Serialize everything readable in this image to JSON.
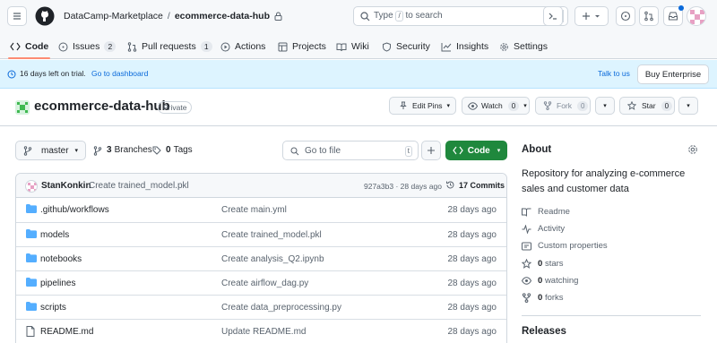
{
  "header": {
    "org": "DataCamp-Marketplace",
    "separator": "/",
    "repo": "ecommerce-data-hub",
    "search_prefix": "Type",
    "search_key": "/",
    "search_suffix": "to search"
  },
  "nav": {
    "tabs": [
      {
        "label": "Code",
        "selected": true
      },
      {
        "label": "Issues",
        "count": "2"
      },
      {
        "label": "Pull requests",
        "count": "1"
      },
      {
        "label": "Actions"
      },
      {
        "label": "Projects"
      },
      {
        "label": "Wiki"
      },
      {
        "label": "Security"
      },
      {
        "label": "Insights"
      },
      {
        "label": "Settings"
      }
    ]
  },
  "banner": {
    "trial": "16 days left on trial.",
    "dashboard_link": "Go to dashboard",
    "talk": "Talk to us",
    "buy": "Buy Enterprise"
  },
  "repo": {
    "name": "ecommerce-data-hub",
    "visibility": "Private",
    "edit_pins": "Edit Pins",
    "watch": "Watch",
    "watch_count": "0",
    "fork": "Fork",
    "fork_count": "0",
    "star": "Star",
    "star_count": "0"
  },
  "toolbar": {
    "branch": "master",
    "branches_count": "3",
    "branches_label": "Branches",
    "tags_count": "0",
    "tags_label": "Tags",
    "goto_placeholder": "Go to file",
    "goto_key": "t",
    "code_label": "Code"
  },
  "commit": {
    "author": "StanKonkin",
    "message": "Create trained_model.pkl",
    "hash_age": "927a3b3 · 28 days ago",
    "commits": "17 Commits"
  },
  "files": [
    {
      "name": ".github/workflows",
      "type": "dir",
      "message": "Create main.yml",
      "age": "28 days ago"
    },
    {
      "name": "models",
      "type": "dir",
      "message": "Create trained_model.pkl",
      "age": "28 days ago"
    },
    {
      "name": "notebooks",
      "type": "dir",
      "message": "Create analysis_Q2.ipynb",
      "age": "28 days ago"
    },
    {
      "name": "pipelines",
      "type": "dir",
      "message": "Create airflow_dag.py",
      "age": "28 days ago"
    },
    {
      "name": "scripts",
      "type": "dir",
      "message": "Create data_preprocessing.py",
      "age": "28 days ago"
    },
    {
      "name": "README.md",
      "type": "file",
      "message": "Update README.md",
      "age": "28 days ago"
    }
  ],
  "about": {
    "title": "About",
    "description": "Repository for analyzing e-commerce sales and customer data",
    "readme": "Readme",
    "activity": "Activity",
    "custom": "Custom properties",
    "stars_count": "0",
    "stars_label": "stars",
    "watching_count": "0",
    "watching_label": "watching",
    "forks_count": "0",
    "forks_label": "forks",
    "releases": "Releases"
  },
  "colors": {
    "accent_green": "#1f883d",
    "link_blue": "#0969da",
    "tab_underline": "#fd8c73",
    "folder_blue": "#54aeff"
  }
}
